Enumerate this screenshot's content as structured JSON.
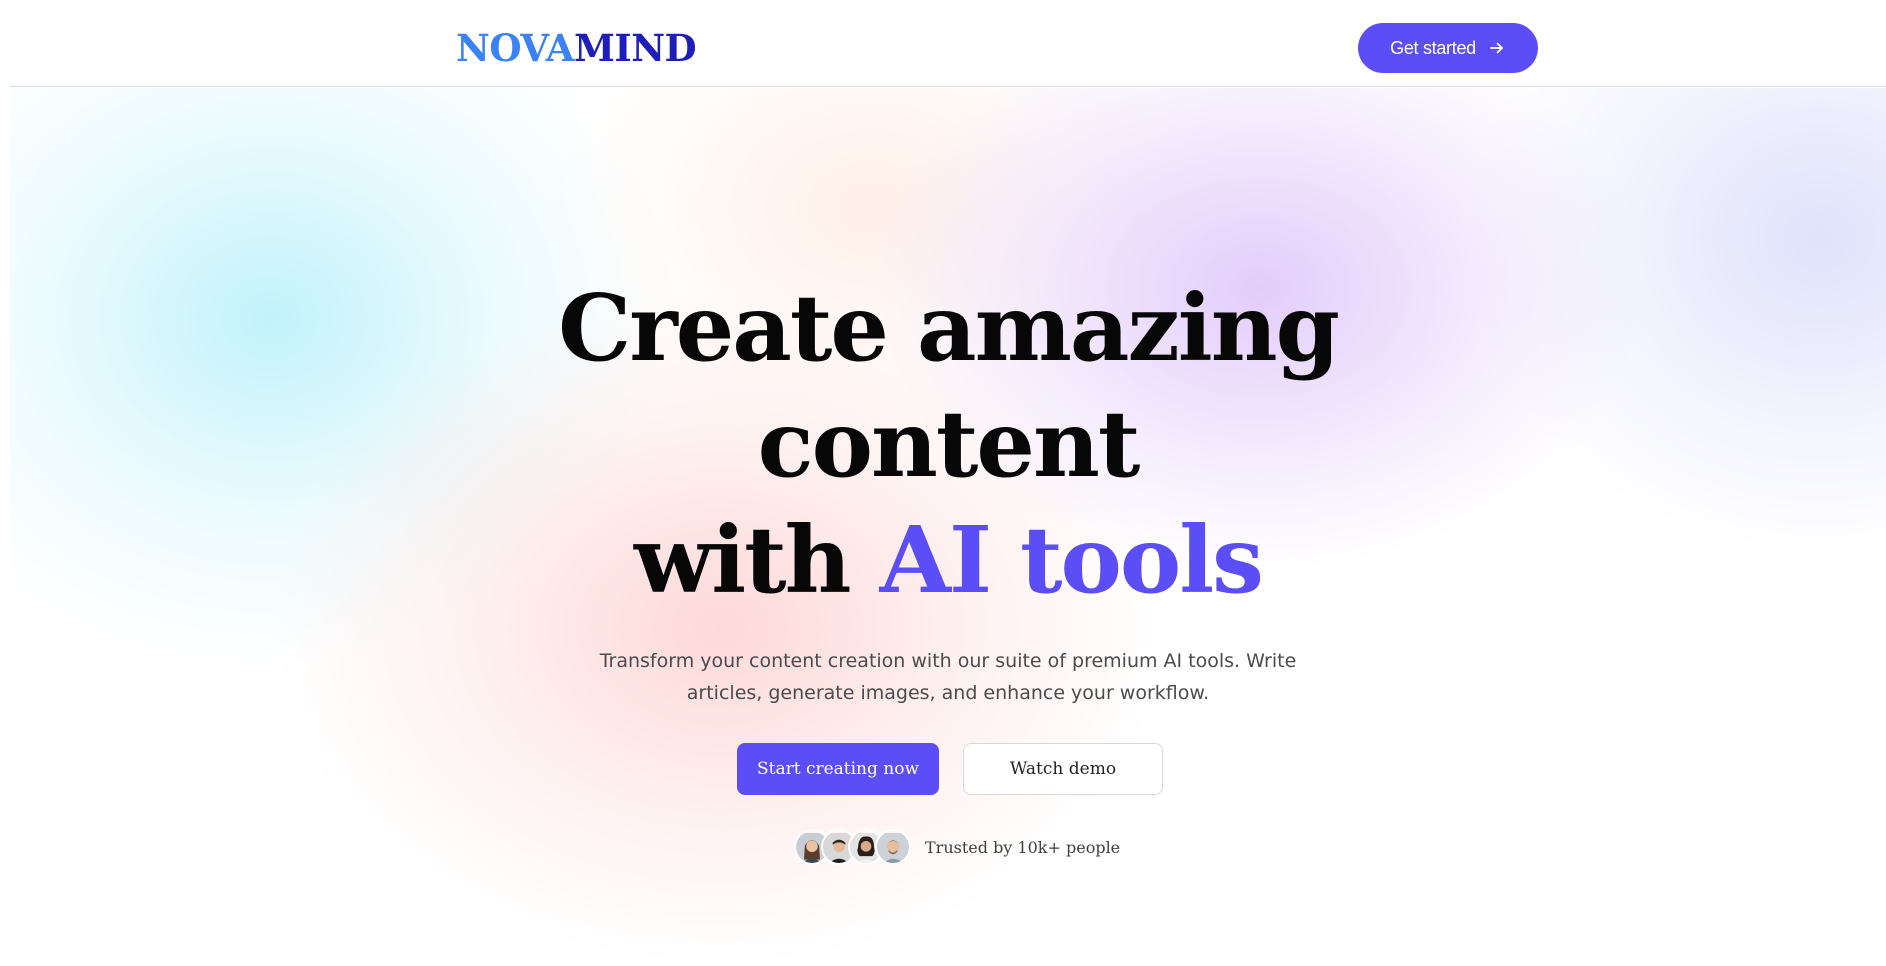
{
  "brand": {
    "logo_part1": "NOVA",
    "logo_part2": "MIND",
    "logo_part1_color": "#3b82f6",
    "logo_part2_color": "#1e1fb8"
  },
  "navbar": {
    "cta_label": "Get started",
    "cta_icon": "arrow-right-icon"
  },
  "hero": {
    "headline_line1": "Create amazing",
    "headline_line2": "content",
    "headline_line3_prefix": "with ",
    "headline_line3_accent": "AI tools",
    "subtitle": "Transform your content creation with our suite of premium AI tools. Write articles, generate images, and enhance your workflow.",
    "primary_button": "Start creating now",
    "secondary_button": "Watch demo",
    "trusted_text": "Trusted by 10k+ people",
    "avatars": [
      "avatar-person-1",
      "avatar-person-2",
      "avatar-person-3",
      "avatar-person-4"
    ]
  },
  "colors": {
    "accent": "#5b4ef7",
    "text_dark": "#070707",
    "text_muted": "#4b4b4b"
  }
}
